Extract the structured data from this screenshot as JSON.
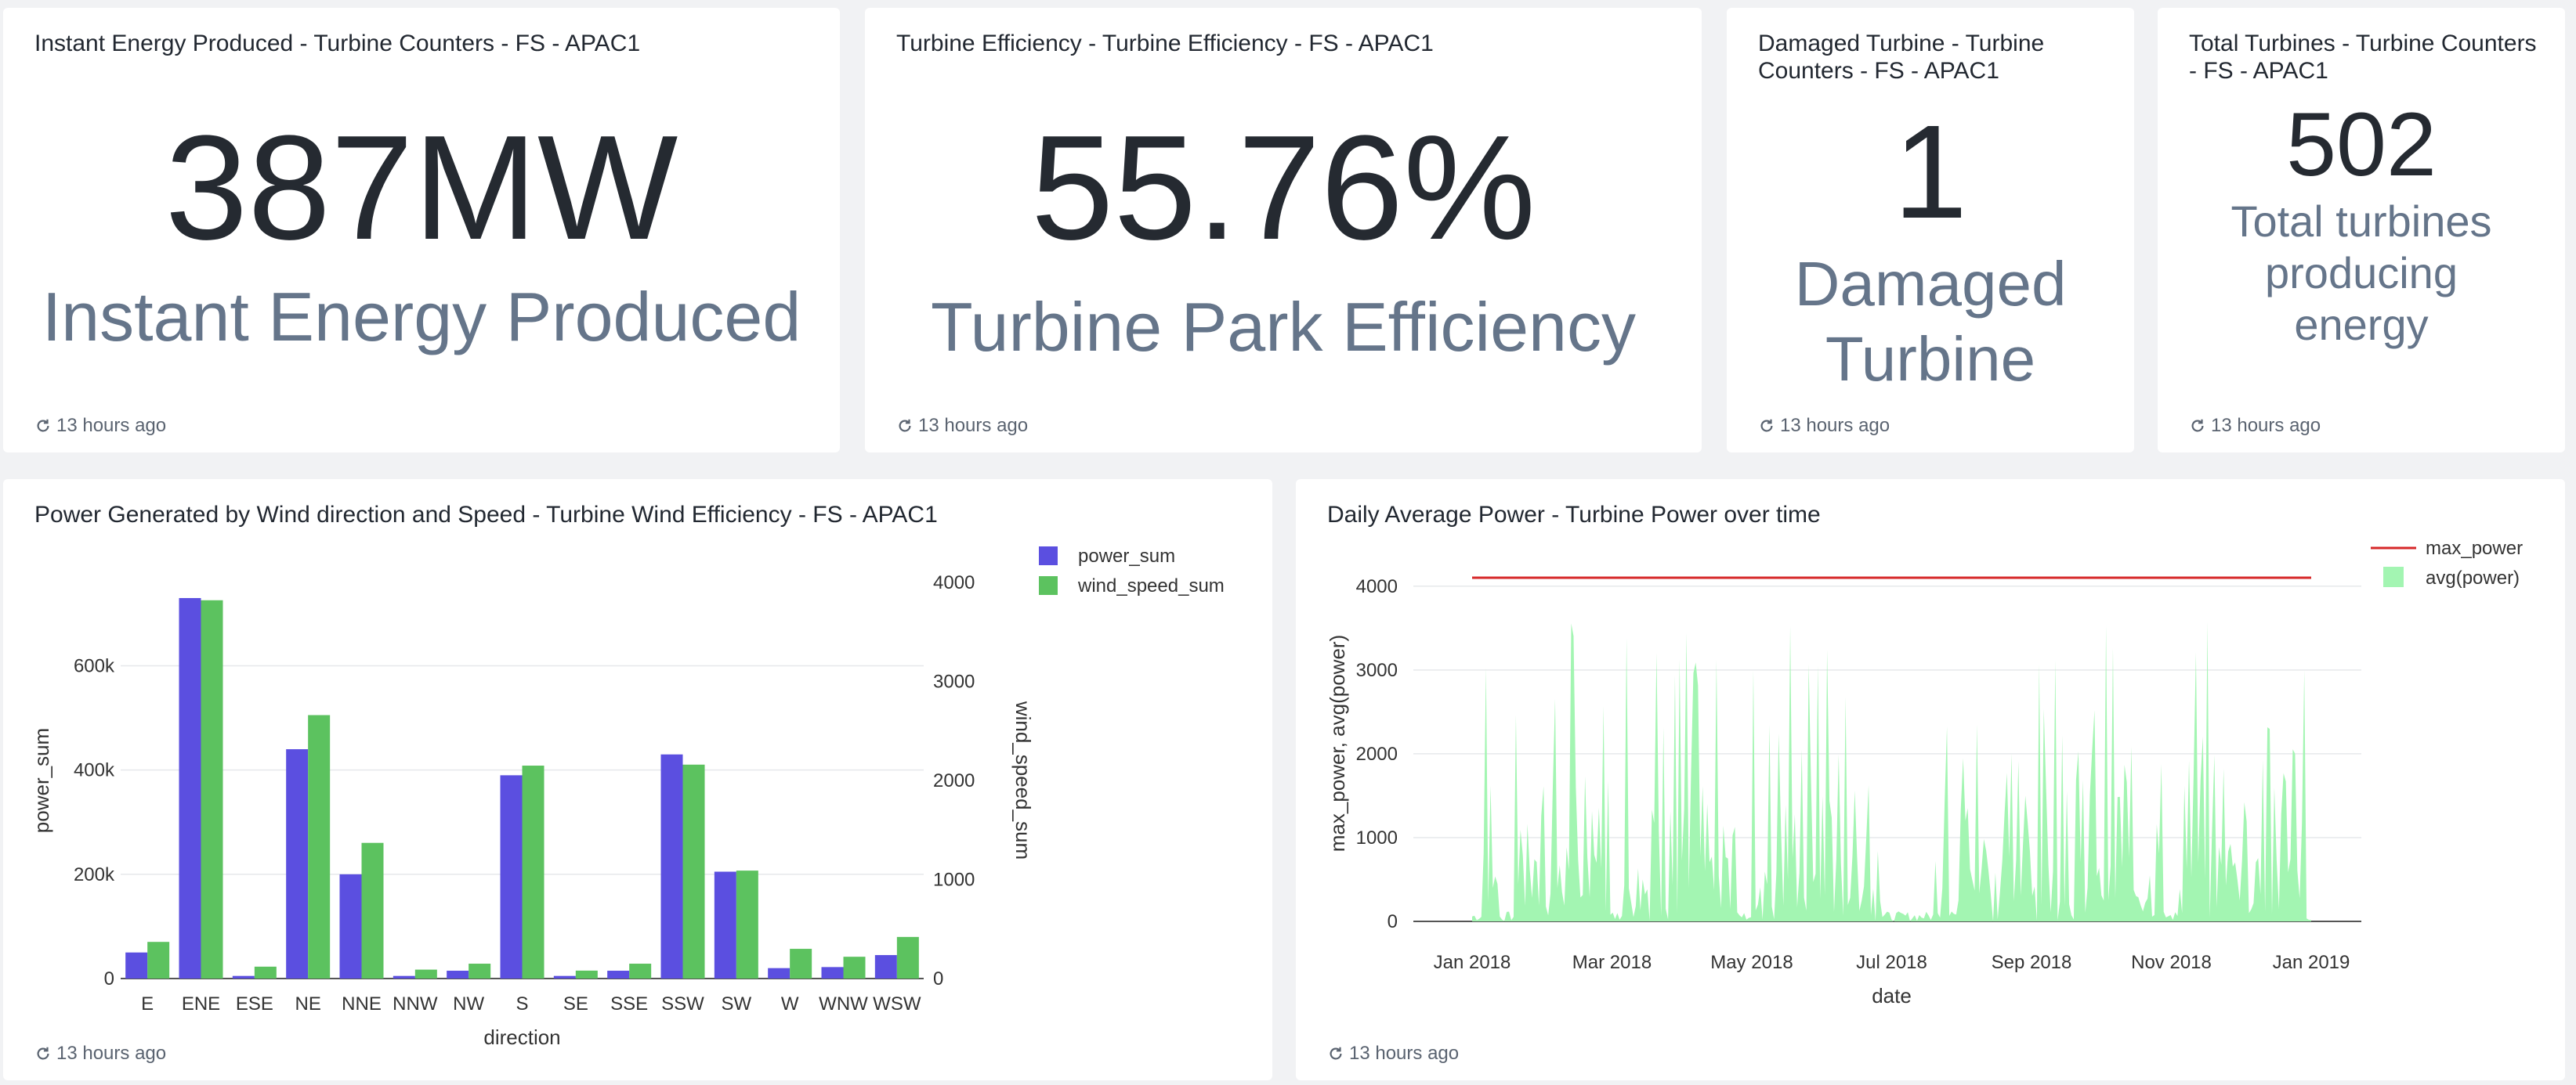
{
  "counters": [
    {
      "title": "Instant Energy Produced - Turbine Counters - FS - APAC1",
      "value": "387MW",
      "label": "Instant Energy Produced",
      "updated": "13 hours ago"
    },
    {
      "title": "Turbine Efficiency - Turbine Efficiency - FS - APAC1",
      "value": "55.76%",
      "label": "Turbine Park Efficiency",
      "updated": "13 hours ago"
    },
    {
      "title": "Damaged Turbine - Turbine Counters - FS - APAC1",
      "value": "1",
      "label": "Damaged Turbine",
      "updated": "13 hours ago"
    },
    {
      "title": "Total Turbines - Turbine Counters - FS - APAC1",
      "value": "502",
      "label": "Total turbines producing energy",
      "updated": "13 hours ago"
    }
  ],
  "wind_panel": {
    "title": "Power Generated by Wind direction and Speed - Turbine Wind Efficiency - FS - APAC1",
    "updated": "13 hours ago"
  },
  "power_panel": {
    "title": "Daily Average Power - Turbine Power over time",
    "updated": "13 hours ago"
  },
  "chart_data": [
    {
      "type": "bar",
      "xlabel": "direction",
      "ylabel": "power_sum",
      "y2label": "wind_speed_sum",
      "categories": [
        "E",
        "ENE",
        "ESE",
        "NE",
        "NNE",
        "NNW",
        "NW",
        "S",
        "SE",
        "SSE",
        "SSW",
        "SW",
        "W",
        "WNW",
        "WSW"
      ],
      "ylim": [
        0,
        760000
      ],
      "y2lim": [
        0,
        4000
      ],
      "yticks": [
        "0",
        "200k",
        "400k",
        "600k"
      ],
      "y2ticks": [
        "0",
        "1000",
        "2000",
        "3000",
        "4000"
      ],
      "legend_position": "top-right",
      "series": [
        {
          "name": "power_sum",
          "axis": "left",
          "color": "#5b4fe0",
          "values": [
            50000,
            730000,
            5000,
            440000,
            200000,
            5000,
            15000,
            390000,
            5000,
            15000,
            430000,
            205000,
            20000,
            22000,
            45000
          ]
        },
        {
          "name": "wind_speed_sum",
          "axis": "right",
          "color": "#5cc25f",
          "values": [
            370,
            3820,
            120,
            2660,
            1370,
            90,
            150,
            2150,
            80,
            150,
            2160,
            1090,
            300,
            220,
            420
          ]
        }
      ]
    },
    {
      "type": "area",
      "xlabel": "date",
      "ylabel": "max_power, avg(power)",
      "ylim": [
        0,
        4250
      ],
      "yticks": [
        "0",
        "1000",
        "2000",
        "3000",
        "4000"
      ],
      "xticks": [
        "Jan 2018",
        "Mar 2018",
        "May 2018",
        "Jul 2018",
        "Sep 2018",
        "Nov 2018",
        "Jan 2019"
      ],
      "xrange": [
        "2018-01-01",
        "2019-01-01"
      ],
      "legend_position": "top-right",
      "series": [
        {
          "name": "max_power",
          "type": "line",
          "color": "#d62728",
          "values": [
            4100,
            4100
          ]
        },
        {
          "name": "avg(power)",
          "type": "area",
          "color": "#a3f5b2"
        }
      ]
    }
  ]
}
